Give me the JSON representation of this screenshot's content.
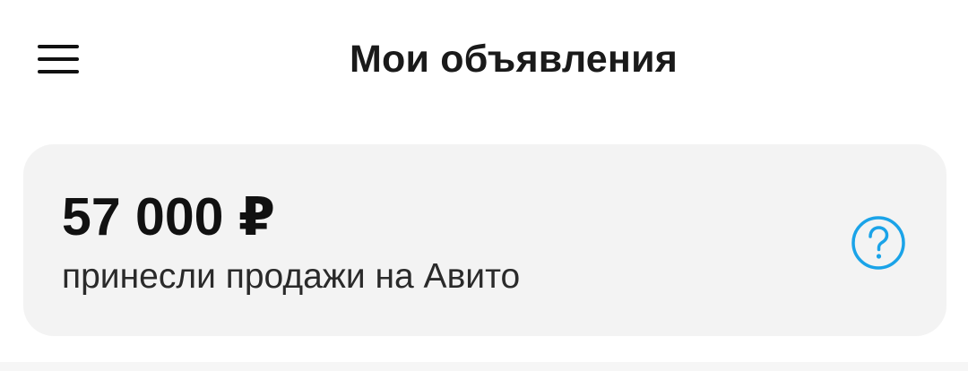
{
  "header": {
    "title": "Мои объявления",
    "menu_icon": "hamburger-menu-icon"
  },
  "sales_card": {
    "amount": "57 000 ₽",
    "caption": "принесли продажи на Авито",
    "help_icon": "question-circle-icon",
    "help_icon_color": "#1aa3e8",
    "background_color": "#f3f3f3"
  }
}
